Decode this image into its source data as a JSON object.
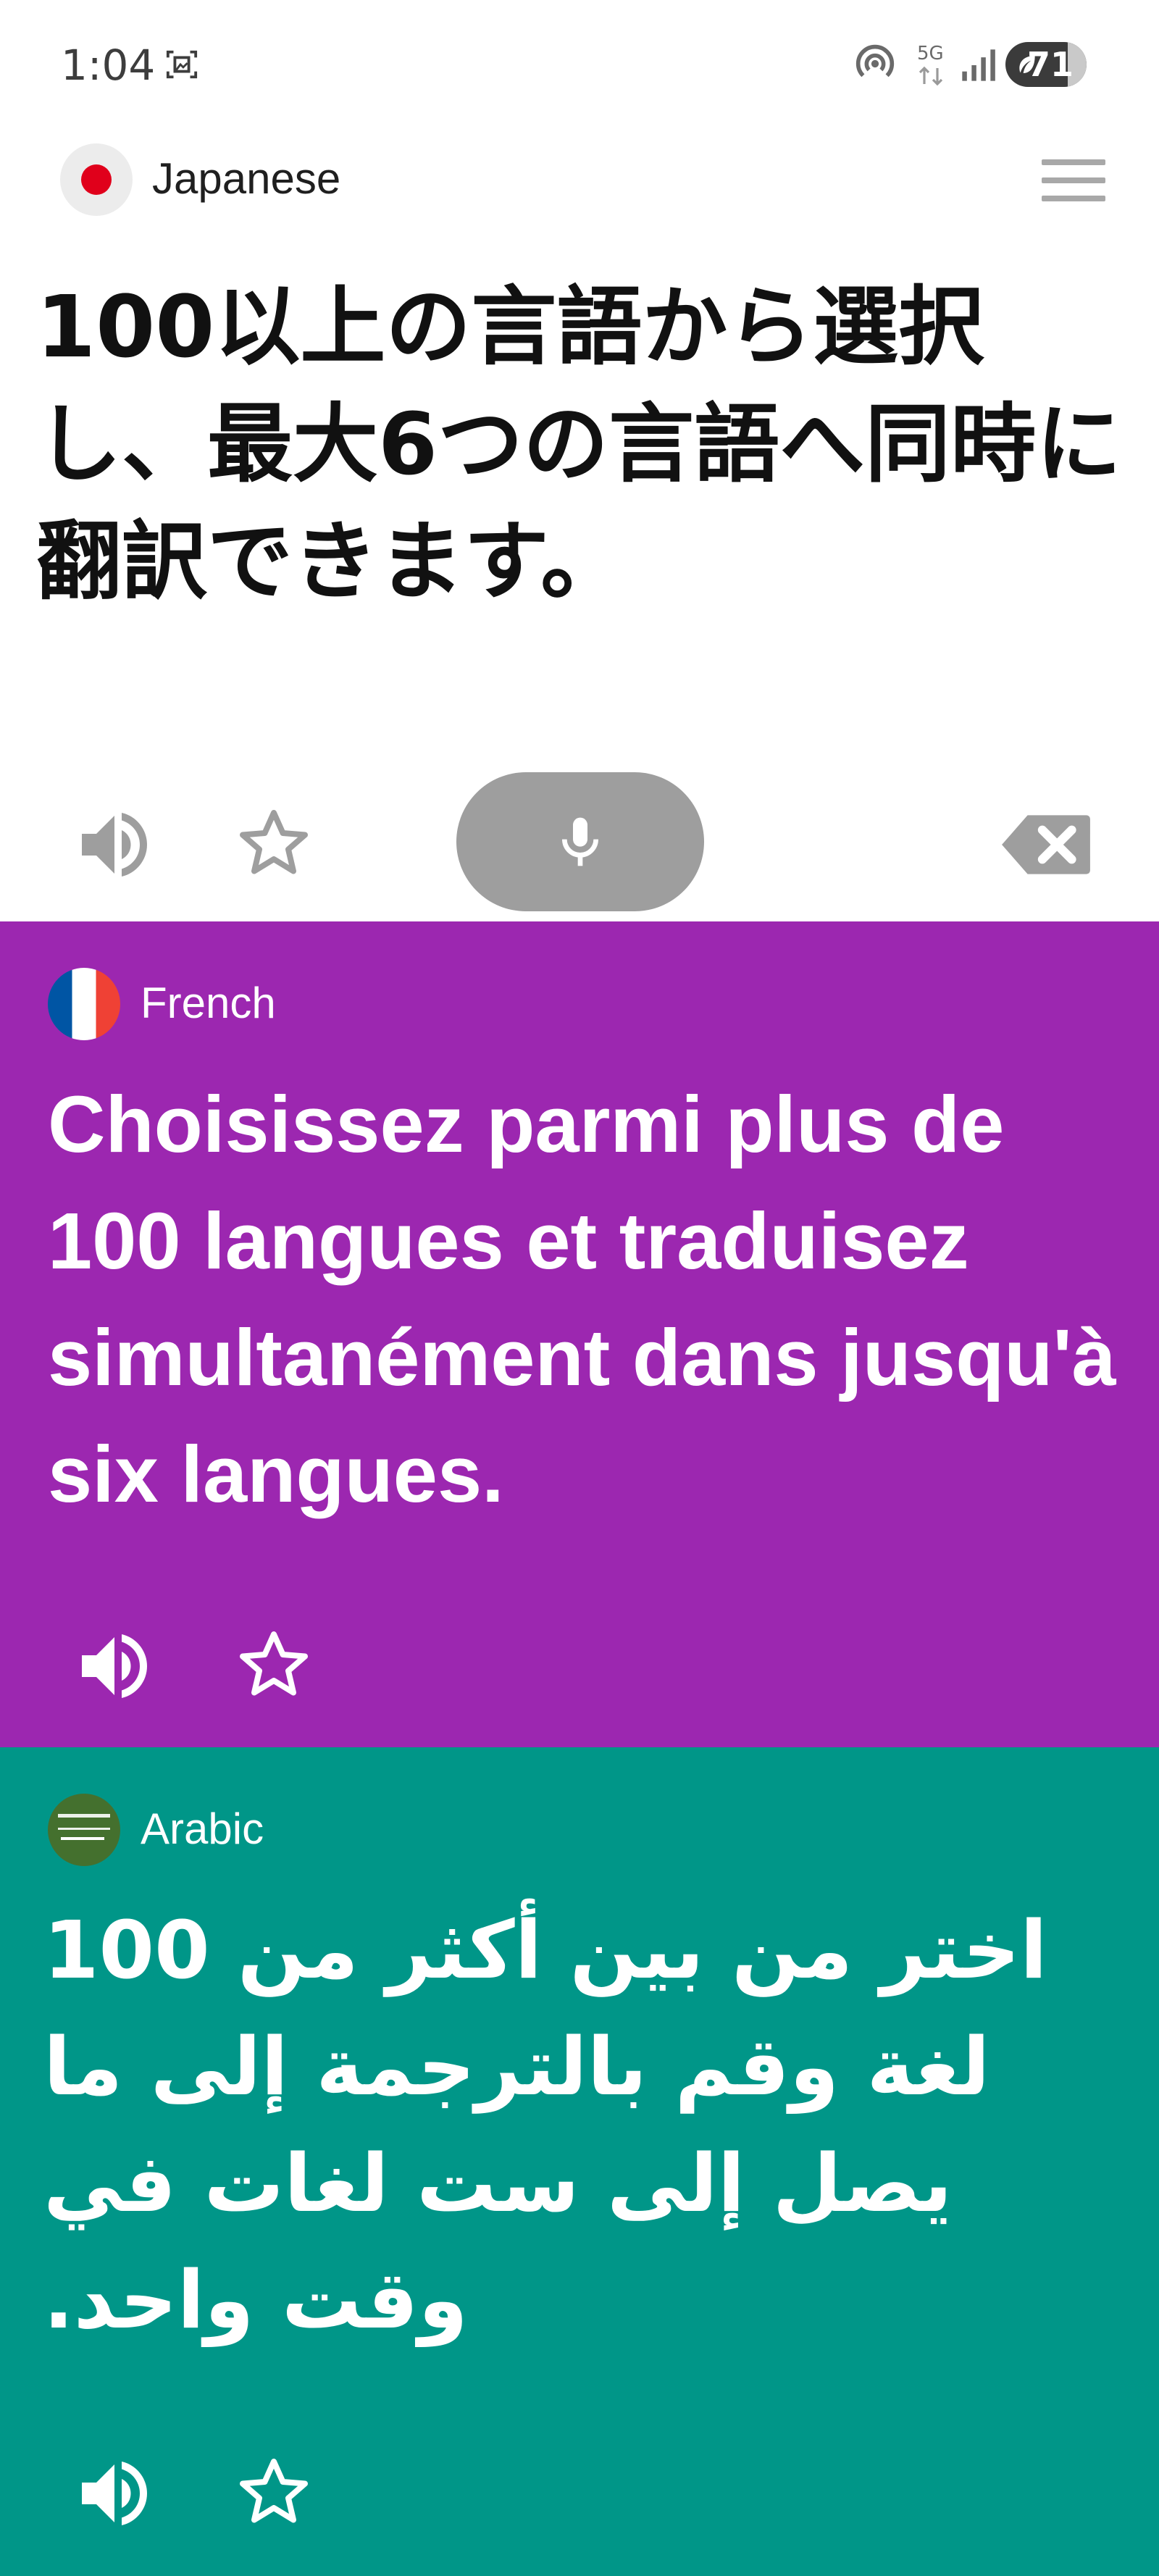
{
  "status_bar": {
    "time": "1:04",
    "network": "5G",
    "battery": "71"
  },
  "source": {
    "language": "Japanese",
    "text": "100以上の言語から選択し、最大6つの言語へ同時に翻訳できます。"
  },
  "translations": [
    {
      "language": "French",
      "text": "Choisissez parmi plus de 100 langues et traduisez simultanément dans jusqu'à six langues.",
      "color": "#9c27b0"
    },
    {
      "language": "Arabic",
      "text": "اختر من بين أكثر من 100 لغة وقم بالترجمة إلى ما يصل إلى ست لغات في وقت واحد.",
      "color": "#009688"
    }
  ],
  "icons": {
    "speaker": "speaker-icon",
    "favorite": "star-outline-icon",
    "microphone": "microphone-icon",
    "clear": "backspace-clear-icon",
    "menu": "hamburger-menu-icon"
  },
  "colors": {
    "mic_button": "#9e9e9e",
    "icon_gray": "#9e9e9e"
  }
}
